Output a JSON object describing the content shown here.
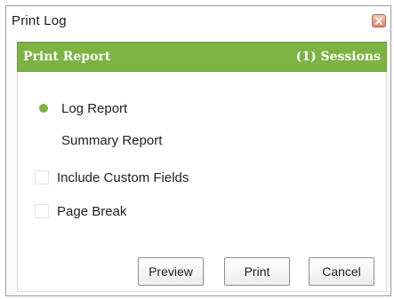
{
  "window": {
    "title": "Print Log"
  },
  "banner": {
    "title": "Print Report",
    "count": "(1) Sessions",
    "color": "#7cb342"
  },
  "report_type": {
    "options": [
      {
        "label": "Log Report",
        "selected": true
      },
      {
        "label": "Summary Report",
        "selected": false
      }
    ]
  },
  "checkboxes": [
    {
      "label": "Include Custom Fields",
      "checked": false
    },
    {
      "label": "Page Break",
      "checked": false
    }
  ],
  "buttons": {
    "preview": "Preview",
    "print": "Print",
    "cancel": "Cancel"
  },
  "icons": {
    "close": "close-icon",
    "selected_radio": "radio-selected-icon"
  }
}
